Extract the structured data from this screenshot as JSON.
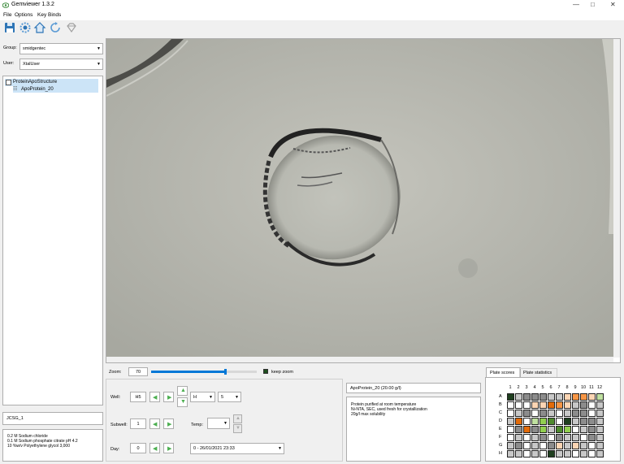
{
  "window": {
    "title": "Gemviewer 1.3.2"
  },
  "menu": [
    "File",
    "Options",
    "Key Binds"
  ],
  "toolbar_icons": [
    "save-icon",
    "settings-icon",
    "home-icon",
    "refresh-icon",
    "diamond-icon"
  ],
  "sidebar": {
    "group_label": "Group:",
    "group_value": "smidgentec",
    "user_label": "User:",
    "user_value": "XtalUser",
    "tree": {
      "root": "ProteinApoStructure",
      "child": "ApoProtein_20"
    },
    "screen_name": "JCSG_1",
    "conditions": [
      "0.2 M Sodium chloride",
      "0.1 M Sodium phosphate citrate pH 4.2",
      "10 %w/v Polyethylene glycol 3,000"
    ]
  },
  "zoom": {
    "label": "Zoom:",
    "value": "70",
    "level_percent": 70,
    "keep_zoom_label": "keep zoom",
    "keep_zoom_checked": true
  },
  "controls": {
    "well_label": "Well:",
    "well_value": "H5",
    "row_value": "H",
    "col_value": "5",
    "subwell_label": "Subwell:",
    "subwell_value": "1",
    "temp_label": "Temp:",
    "temp_value": "",
    "day_label": "Day:",
    "day_value": "0",
    "date_value": "0 - 26/01/2021 23:33"
  },
  "protein": {
    "name": "ApoProtein_20 (20.00 g/l)",
    "notes": [
      "Protein purified at room temperature",
      "Ni-NTA, SEC, used fresh for crystallization",
      "20g/l max solubility"
    ]
  },
  "plate": {
    "tabs": [
      "Plate scores",
      "Plate statistics"
    ],
    "cols": [
      "1",
      "2",
      "3",
      "4",
      "5",
      "6",
      "7",
      "8",
      "9",
      "10",
      "11",
      "12"
    ],
    "rows": [
      "A",
      "B",
      "C",
      "D",
      "E",
      "F",
      "G",
      "H"
    ],
    "colors": {
      "W": "#ffffff",
      "L": "#c8c8c8",
      "G": "#8c8c8c",
      "D": "#1f3f1f",
      "P": "#fcd5b4",
      "O": "#f79646",
      "R": "#e26b0a",
      "g": "#92d050",
      "a": "#bfe0a0",
      "k": "#4e8a2e",
      "E": "#9bbb59"
    },
    "cells": [
      "DLGGGLLPOOPa",
      "WWWPPROPLGWL",
      "WLGWGLWLGGWL",
      "LRWagkWDLGGL",
      "WGRGgLkgWLGL",
      "WLWLGWGLLWGL",
      "LGWLWGPLPLWL",
      "LLWLWDLLWLWL"
    ]
  }
}
